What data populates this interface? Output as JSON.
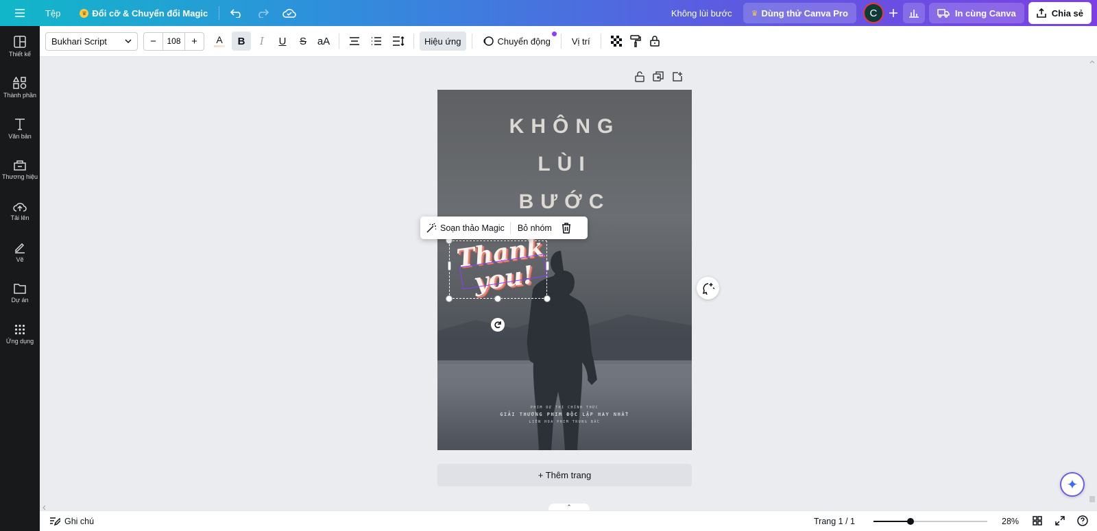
{
  "topbar": {
    "menu_icon": "hamburger-icon",
    "file_label": "Tệp",
    "magic_resize_label": "Đổi cỡ & Chuyển đổi Magic",
    "doc_title": "Không lùi bước",
    "try_pro_label": "Dùng thử Canva Pro",
    "avatar_initial": "C",
    "print_label": "In cùng Canva",
    "share_label": "Chia sẻ"
  },
  "sidebar": {
    "items": [
      {
        "label": "Thiết kế",
        "icon": "layout-icon"
      },
      {
        "label": "Thành phần",
        "icon": "shapes-icon"
      },
      {
        "label": "Văn bản",
        "icon": "text-icon"
      },
      {
        "label": "Thương hiệu",
        "icon": "brand-icon"
      },
      {
        "label": "Tải lên",
        "icon": "upload-icon"
      },
      {
        "label": "Vẽ",
        "icon": "draw-icon"
      },
      {
        "label": "Dự án",
        "icon": "folder-icon"
      },
      {
        "label": "Ứng dụng",
        "icon": "apps-icon"
      }
    ]
  },
  "toolbar": {
    "font_name": "Bukhari Script",
    "font_size": "108",
    "minus": "−",
    "plus": "+",
    "text_color_glyph": "A",
    "bold_glyph": "B",
    "italic_glyph": "I",
    "underline_glyph": "U",
    "strike_glyph": "S",
    "case_glyph": "aA",
    "effects_label": "Hiệu ứng",
    "animate_label": "Chuyển động",
    "position_label": "Vị trí"
  },
  "canvas": {
    "title_lines": [
      "KHÔNG",
      "LÙI",
      "BƯỚC"
    ],
    "credit_small_1": "PHIM DỰ THI CHÍNH THỨC",
    "credit_big": "GIẢI THƯỞNG PHIM ĐỘC LẬP HAY NHẤT",
    "credit_small_2": "LIÊN HOA PHIM TRUNG BẮC",
    "sticker_text": "Thank you!",
    "add_page_label": "+ Thêm trang"
  },
  "context_menu": {
    "magic_write_label": "Soạn thảo Magic",
    "ungroup_label": "Bỏ nhóm"
  },
  "bottombar": {
    "notes_label": "Ghi chú",
    "page_label": "Trang 1 / 1",
    "zoom_label": "28%",
    "zoom_fraction": 0.28
  },
  "colors": {
    "selection_accent": "#8b3dff",
    "magic_button_border": "#6b5cf0"
  }
}
